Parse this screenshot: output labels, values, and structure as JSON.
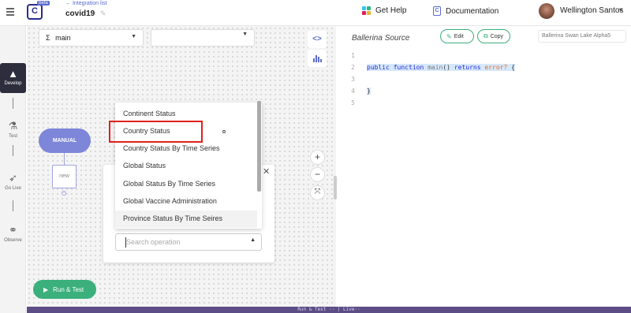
{
  "header": {
    "beta_label": "beta",
    "back_link": "← Integration list",
    "project_title": "covid19",
    "get_help_label": "Get Help",
    "documentation_label": "Documentation",
    "doc_icon_glyph": "C",
    "username": "Wellington Santos"
  },
  "leftnav": {
    "items": [
      {
        "label": "Develop",
        "icon": "develop-icon",
        "active": true
      },
      {
        "label": "Test",
        "icon": "flask-icon"
      },
      {
        "label": "Go Live",
        "icon": "rocket-icon"
      },
      {
        "label": "Observe",
        "icon": "binoculars-icon"
      }
    ]
  },
  "canvas": {
    "function_select": {
      "prefix": "Σ",
      "value": "main"
    },
    "second_select": {
      "value": ""
    },
    "manual_node_label": "MANUAL",
    "new_node_label": "new",
    "run_test_label": "Run & Test"
  },
  "operation_panel": {
    "search_placeholder": "Search operation",
    "options": [
      "Continent Status",
      "Country Status",
      "Country Status By Time Series",
      "Global Status",
      "Global Status By Time Series",
      "Global Vaccine Administration",
      "Province Status By Time Seires"
    ],
    "highlighted_option": "Country Status",
    "hovered_option": "Province Status By Time Seires"
  },
  "source": {
    "title": "Ballerina Source",
    "edit_label": "Edit",
    "copy_label": "Copy",
    "version_label": "Ballerina Swan Lake Alpha5",
    "line_numbers": [
      "1",
      "2",
      "3",
      "4",
      "5"
    ],
    "code": {
      "kw1": "public",
      "kw2": "function",
      "fn": "main",
      "paren": "()",
      "kw3": "returns",
      "type": "error?",
      "open": "{",
      "close": "}"
    }
  },
  "status_bar": {
    "text": "Run & Test ·· | Live··"
  },
  "colors": {
    "accent": "#5b6ad0",
    "green": "#3bb07c",
    "highlight_red": "#e0201c",
    "node_purple": "#7d86d8"
  }
}
